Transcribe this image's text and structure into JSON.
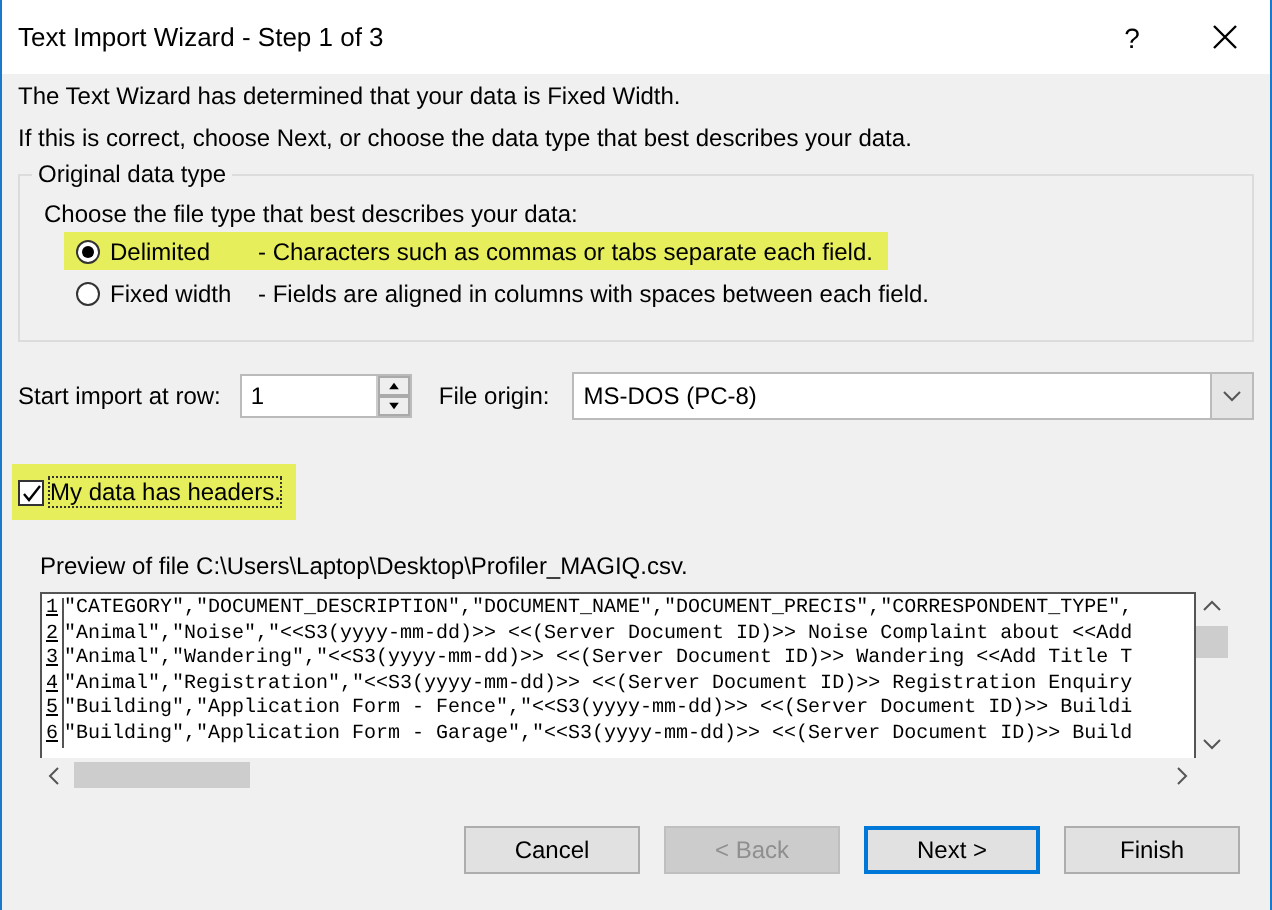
{
  "window": {
    "title": "Text Import Wizard - Step 1 of 3",
    "help": "?"
  },
  "intro": [
    "The Text Wizard has determined that your data is Fixed Width.",
    "If this is correct, choose Next, or choose the data type that best describes your data."
  ],
  "group": {
    "title": "Original data type",
    "prompt": "Choose the file type that best describes your data:",
    "options": [
      {
        "label": "Delimited",
        "description": "- Characters such as commas or tabs separate each field.",
        "selected": true,
        "highlighted": true
      },
      {
        "label": "Fixed width",
        "description": "- Fields are aligned in columns with spaces between each field.",
        "selected": false,
        "highlighted": false
      }
    ]
  },
  "start_row": {
    "label": "Start import at row:",
    "value": "1"
  },
  "file_origin": {
    "label": "File origin:",
    "value": "MS-DOS (PC-8)"
  },
  "headers": {
    "label": "My data has headers.",
    "checked": true,
    "highlighted": true
  },
  "preview": {
    "label": "Preview of file C:\\Users\\Laptop\\Desktop\\Profiler_MAGIQ.csv.",
    "rows": [
      {
        "number": "1",
        "text": "\"CATEGORY\",\"DOCUMENT_DESCRIPTION\",\"DOCUMENT_NAME\",\"DOCUMENT_PRECIS\",\"CORRESPONDENT_TYPE\","
      },
      {
        "number": "2",
        "text": "\"Animal\",\"Noise\",\"<<S3(yyyy-mm-dd)>> <<(Server Document ID)>> Noise Complaint about <<Add"
      },
      {
        "number": "3",
        "text": "\"Animal\",\"Wandering\",\"<<S3(yyyy-mm-dd)>> <<(Server Document ID)>> Wandering <<Add Title T"
      },
      {
        "number": "4",
        "text": "\"Animal\",\"Registration\",\"<<S3(yyyy-mm-dd)>> <<(Server Document ID)>> Registration Enquiry"
      },
      {
        "number": "5",
        "text": "\"Building\",\"Application Form - Fence\",\"<<S3(yyyy-mm-dd)>> <<(Server Document ID)>> Buildi"
      },
      {
        "number": "6",
        "text": "\"Building\",\"Application Form - Garage\",\"<<S3(yyyy-mm-dd)>> <<(Server Document ID)>> Build"
      }
    ]
  },
  "buttons": [
    {
      "label": "Cancel",
      "disabled": false,
      "default": false
    },
    {
      "label": "< Back",
      "disabled": true,
      "default": false
    },
    {
      "label": "Next >",
      "disabled": false,
      "default": true
    },
    {
      "label": "Finish",
      "disabled": false,
      "default": false
    }
  ]
}
